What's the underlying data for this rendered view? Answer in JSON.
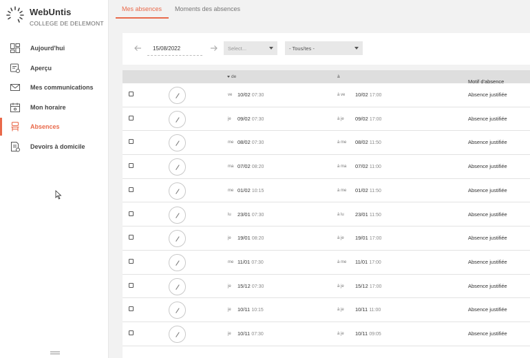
{
  "brand": {
    "name": "WebUntis",
    "school": "COLLEGE DE DELEMONT"
  },
  "nav": [
    {
      "label": "Aujourd'hui",
      "icon": "dashboard-icon",
      "active": false
    },
    {
      "label": "Aperçu",
      "icon": "overview-icon",
      "active": false
    },
    {
      "label": "Mes communications",
      "icon": "mail-icon",
      "active": false
    },
    {
      "label": "Mon horaire",
      "icon": "calendar-icon",
      "active": false
    },
    {
      "label": "Absences",
      "icon": "chair-icon",
      "active": true
    },
    {
      "label": "Devoirs à domicile",
      "icon": "homework-icon",
      "active": false
    }
  ],
  "tabs": {
    "active": "Mes absences",
    "inactive": "Moments des absences"
  },
  "filter": {
    "date": "15/08/2022",
    "select1_placeholder": "Select...",
    "select2_value": "- Tous/tes -"
  },
  "table": {
    "headers": {
      "de": "de",
      "a": "à",
      "motif": "Motif d'absence"
    },
    "rows": [
      {
        "day_from": "ve",
        "date_from": "10/02",
        "time_from": "07:30",
        "day_to": "à ve",
        "date_to": "10/02",
        "time_to": "17:00",
        "motif": "Absence justifiée"
      },
      {
        "day_from": "je",
        "date_from": "09/02",
        "time_from": "07:30",
        "day_to": "à je",
        "date_to": "09/02",
        "time_to": "17:00",
        "motif": "Absence justifiée"
      },
      {
        "day_from": "me",
        "date_from": "08/02",
        "time_from": "07:30",
        "day_to": "à me",
        "date_to": "08/02",
        "time_to": "11:50",
        "motif": "Absence justifiée"
      },
      {
        "day_from": "ma",
        "date_from": "07/02",
        "time_from": "08:20",
        "day_to": "à ma",
        "date_to": "07/02",
        "time_to": "11:00",
        "motif": "Absence justifiée"
      },
      {
        "day_from": "me",
        "date_from": "01/02",
        "time_from": "10:15",
        "day_to": "à me",
        "date_to": "01/02",
        "time_to": "11:50",
        "motif": "Absence justifiée"
      },
      {
        "day_from": "lu",
        "date_from": "23/01",
        "time_from": "07:30",
        "day_to": "à lu",
        "date_to": "23/01",
        "time_to": "11:50",
        "motif": "Absence justifiée"
      },
      {
        "day_from": "je",
        "date_from": "19/01",
        "time_from": "08:20",
        "day_to": "à je",
        "date_to": "19/01",
        "time_to": "17:00",
        "motif": "Absence justifiée"
      },
      {
        "day_from": "me",
        "date_from": "11/01",
        "time_from": "07:30",
        "day_to": "à me",
        "date_to": "11/01",
        "time_to": "17:00",
        "motif": "Absence justifiée"
      },
      {
        "day_from": "je",
        "date_from": "15/12",
        "time_from": "07:30",
        "day_to": "à je",
        "date_to": "15/12",
        "time_to": "17:00",
        "motif": "Absence justifiée"
      },
      {
        "day_from": "je",
        "date_from": "10/11",
        "time_from": "10:15",
        "day_to": "à je",
        "date_to": "10/11",
        "time_to": "11:00",
        "motif": "Absence justifiée"
      },
      {
        "day_from": "je",
        "date_from": "10/11",
        "time_from": "07:30",
        "day_to": "à je",
        "date_to": "10/11",
        "time_to": "09:05",
        "motif": "Absence justifiée"
      }
    ]
  },
  "colors": {
    "accent": "#e9694a",
    "header_bg": "#dedede",
    "page_bg": "#f2f2f2"
  }
}
